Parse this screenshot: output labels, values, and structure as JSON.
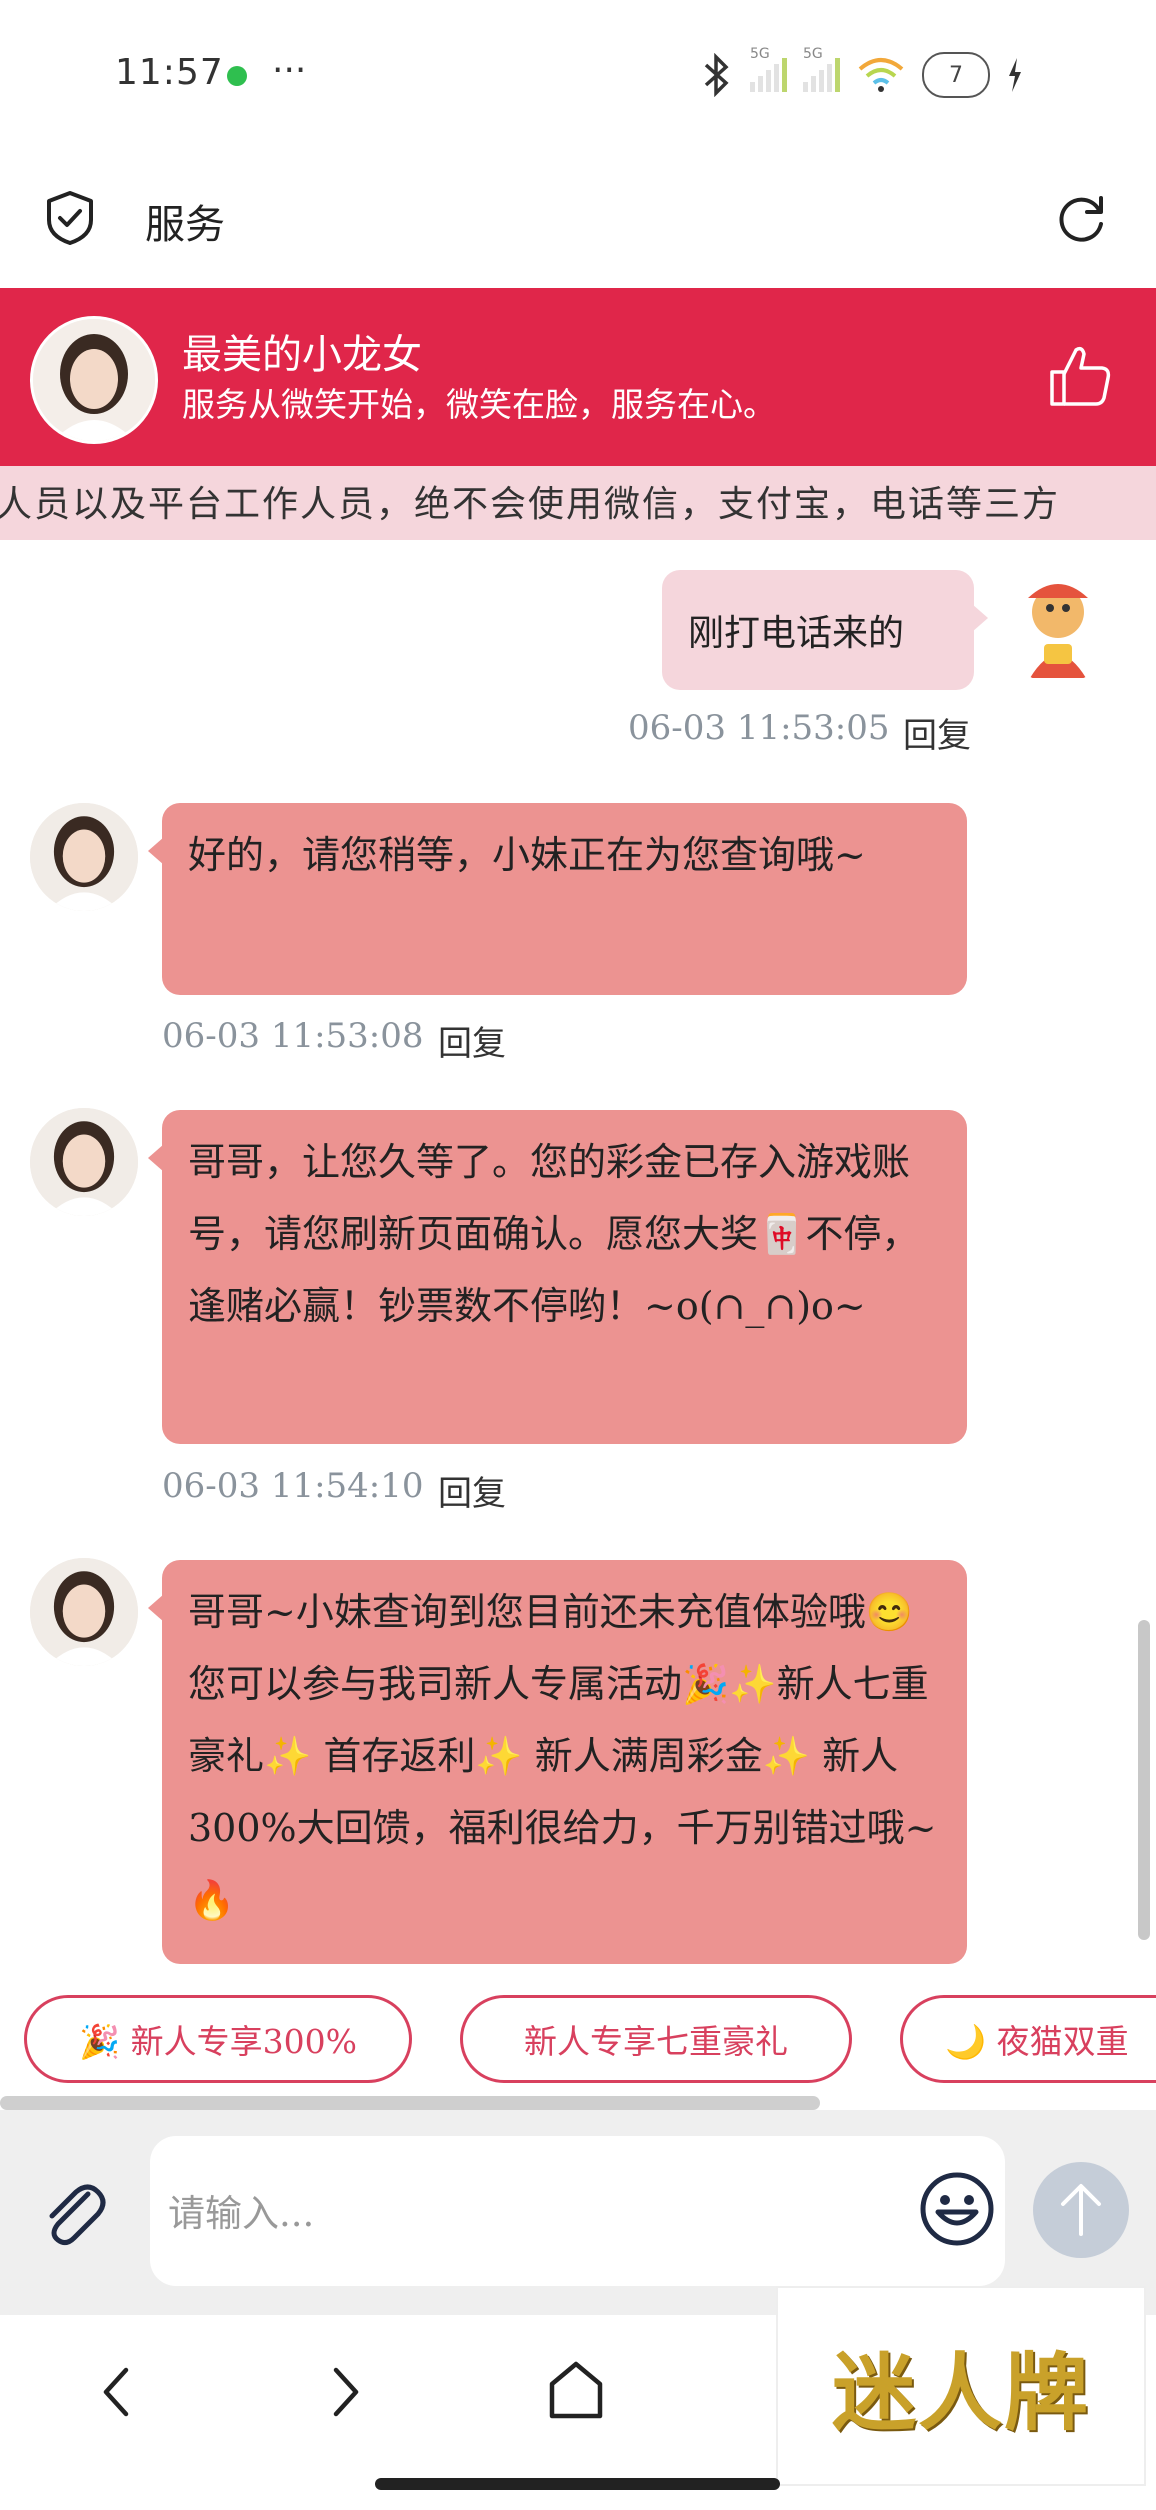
{
  "status_bar": {
    "time": "11:57",
    "more": "···",
    "signal1_label": "5G",
    "signal2_label": "5G",
    "battery": "7"
  },
  "header": {
    "title": "服务",
    "icon_left": "shield-check-icon",
    "icon_right": "refresh-icon"
  },
  "banner": {
    "name": "最美的小龙女",
    "slogan": "服务从微笑开始，微笑在脸，服务在心。",
    "bg_color": "#e0264a"
  },
  "marquee": {
    "text": "人员以及平台工作人员，绝不会使用微信，支付宝，电话等三方"
  },
  "messages": [
    {
      "side": "right",
      "text": "刚打电话来的",
      "time": "06-03 11:53:05",
      "reply": "回复"
    },
    {
      "side": "left",
      "text": "好的，请您稍等，小妹正在为您查询哦~",
      "time": "06-03 11:53:08",
      "reply": "回复"
    },
    {
      "side": "left",
      "text": "哥哥，让您久等了。您的彩金已存入游戏账号，请您刷新页面确认。愿您大奖🀄不停，逢赌必赢！钞票数不停哟！~o(∩_∩)o~",
      "time": "06-03 11:54:10",
      "reply": "回复"
    },
    {
      "side": "left",
      "text": "哥哥~小妹查询到您目前还未充值体验哦😊您可以参与我司新人专属活动🎉✨新人七重豪礼✨ 首存返利✨ 新人满周彩金✨ 新人300%大回馈，福利很给力，千万别错过哦~🔥"
    }
  ],
  "quick_replies": [
    "🎉 新人专享300%",
    "新人专享七重豪礼",
    "🌙 夜猫双重"
  ],
  "input": {
    "placeholder": "请输入..."
  },
  "ad": {
    "text": "迷人牌"
  }
}
